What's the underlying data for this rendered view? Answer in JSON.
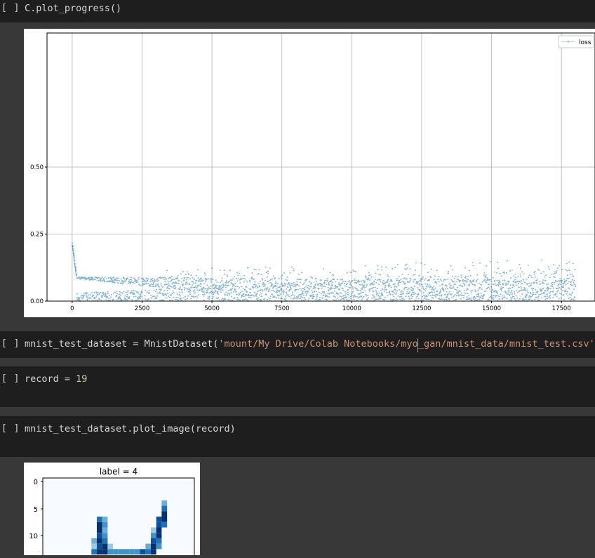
{
  "cells": [
    {
      "run_label": "[ ]",
      "code": "C.plot_progress()"
    },
    {
      "run_label": "[ ]",
      "code_prefix": "mnist_test_dataset = MnistDataset(",
      "code_string": "'mount/My Drive/Colab Notebooks/myo_gan/mnist_data/mnist_test.csv'",
      "code_suffix": ")"
    },
    {
      "run_label": "[ ]",
      "code_prefix": "record = ",
      "code_number": "19"
    },
    {
      "run_label": "[ ]",
      "code": "mnist_test_dataset.plot_image(record)"
    }
  ],
  "chart_data": {
    "type": "scatter",
    "legend": [
      "loss"
    ],
    "legend_position": "top-right",
    "grid": true,
    "series": [
      {
        "name": "loss",
        "color": "#1f77b4"
      }
    ],
    "x_ticks": [
      "0",
      "2500",
      "5000",
      "7500",
      "10000",
      "12500",
      "15000",
      "17500"
    ],
    "y_ticks": [
      "0.00",
      "0.25",
      "0.50"
    ],
    "xlim": [
      -900,
      18700
    ],
    "ylim": [
      0,
      1
    ],
    "n_points": 18000,
    "initial_loss": 0.21,
    "plateau_loss": 0.09,
    "max_spike": 0.19
  },
  "image_plot": {
    "title": "label = 4",
    "y_ticks": [
      "0",
      "5",
      "10"
    ],
    "cmap": "Blues"
  }
}
